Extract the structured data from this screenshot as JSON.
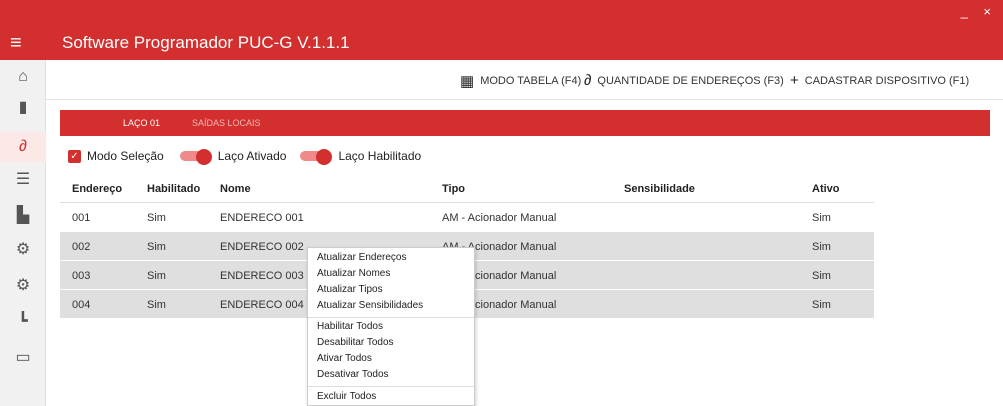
{
  "window": {
    "controls": "_ ×"
  },
  "appbar": {
    "menu_icon": "hamburger-icon",
    "title": "Software Programador PUC-G V.1.1.1"
  },
  "sidebar": {
    "items": [
      {
        "icon": "home-icon",
        "glyph": "⌂",
        "active": false
      },
      {
        "icon": "document-icon",
        "glyph": "▮",
        "active": false
      },
      {
        "icon": "loop-icon",
        "glyph": "∂",
        "active": true
      },
      {
        "icon": "list-icon",
        "glyph": "☰",
        "active": false
      },
      {
        "icon": "book-icon",
        "glyph": "▙",
        "active": false
      },
      {
        "icon": "gear-icon",
        "glyph": "⚙",
        "active": false
      },
      {
        "icon": "settings-device-icon",
        "glyph": "⚙",
        "active": false
      },
      {
        "icon": "network-icon",
        "glyph": "┗",
        "active": false
      },
      {
        "icon": "window-settings-icon",
        "glyph": "▭",
        "active": false
      }
    ]
  },
  "toolbar": {
    "table_mode_label": "MODO TABELA (F4)",
    "address_count_label": "QUANTIDADE DE ENDEREÇOS (F3)",
    "register_device_label": "CADASTRAR DISPOSITIVO (F1)"
  },
  "tabs": {
    "loop": "LAÇO 01",
    "local_outputs": "SAÍDAS LOCAIS"
  },
  "controls": {
    "select_mode": "Modo Seleção",
    "loop_enabled": "Laço Ativado",
    "loop_habilitated": "Laço Habilitado"
  },
  "table": {
    "headers": [
      "Endereço",
      "Habilitado",
      "Nome",
      "Tipo",
      "Sensibilidade",
      "Ativo"
    ],
    "rows": [
      [
        "001",
        "Sim",
        "ENDERECO 001",
        "AM - Acionador Manual",
        "",
        "Sim"
      ],
      [
        "002",
        "Sim",
        "ENDERECO 002",
        "AM - Acionador Manual",
        "",
        "Sim"
      ],
      [
        "003",
        "Sim",
        "ENDERECO 003",
        "AM - Acionador Manual",
        "",
        "Sim"
      ],
      [
        "004",
        "Sim",
        "ENDERECO 004",
        "AM - Acionador Manual",
        "",
        "Sim"
      ]
    ]
  },
  "context_menu": {
    "items": [
      "Atualizar Endereços",
      "Atualizar Nomes",
      "Atualizar Tipos",
      "Atualizar Sensibilidades",
      "Habilitar Todos",
      "Desabilitar Todos",
      "Ativar Todos",
      "Desativar Todos",
      "Excluir Todos"
    ]
  },
  "colors": {
    "accent": "#d32f2f"
  }
}
